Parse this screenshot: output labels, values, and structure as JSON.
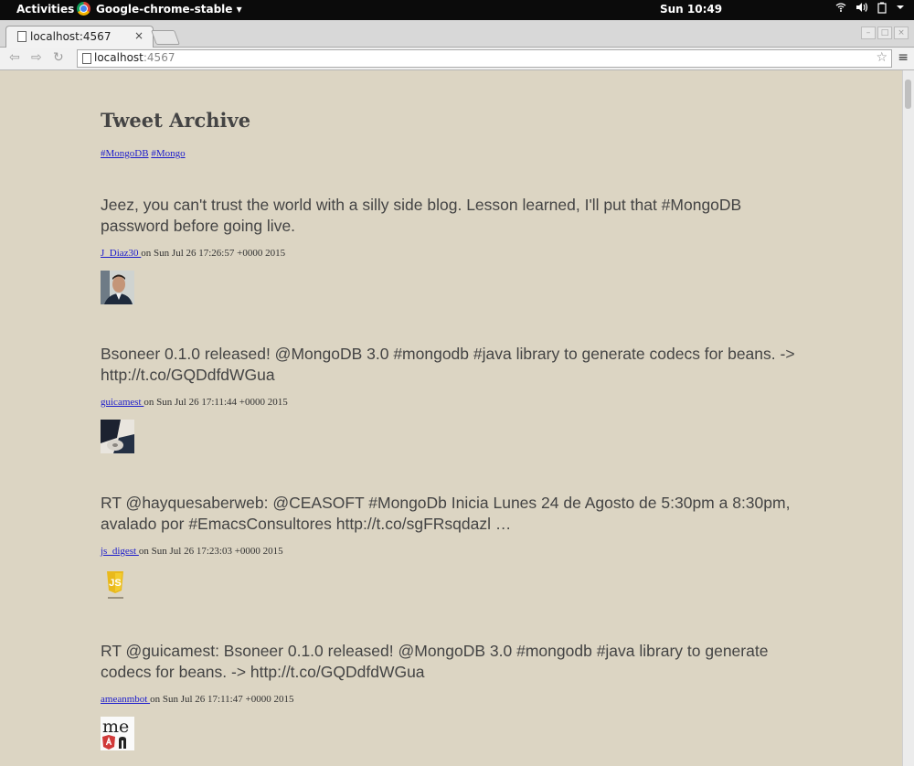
{
  "os": {
    "activities": "Activities",
    "app_menu": "Google-chrome-stable ▾",
    "clock": "Sun 10:49",
    "tray_icons": [
      "wifi-icon",
      "volume-icon",
      "battery-icon",
      "system-menu-icon"
    ]
  },
  "browser": {
    "tab_title": "localhost:4567",
    "url_host": "localhost",
    "url_port": ":4567"
  },
  "page": {
    "title": "Tweet Archive",
    "tags": [
      "#MongoDB",
      "#Mongo"
    ],
    "tweets": [
      {
        "text": "Jeez, you can't trust the world with a silly side blog. Lesson learned, I'll put that #MongoDB password before going live.",
        "user": "J_Diaz30 ",
        "date": " on Sun Jul 26 17:26:57 +0000 2015",
        "avatar": "person-photo"
      },
      {
        "text": "Bsoneer 0.1.0 released! @MongoDB 3.0 #mongodb #java library to generate codecs for beans. -> http://t.co/GQDdfdWGua",
        "user": "guicamest ",
        "date": " on Sun Jul 26 17:11:44 +0000 2015",
        "avatar": "dark-photo"
      },
      {
        "text": "RT @hayquesaberweb: @CEASOFT #MongoDb Inicia Lunes 24 de Agosto de 5:30pm a 8:30pm, avalado por #EmacsConsultores http://t.co/sgFRsqdazl …",
        "user": "js_digest ",
        "date": " on Sun Jul 26 17:23:03 +0000 2015",
        "avatar": "javascript-shield"
      },
      {
        "text": "RT @guicamest: Bsoneer 0.1.0 released! @MongoDB 3.0 #mongodb #java library to generate codecs for beans. -> http://t.co/GQDdfdWGua",
        "user": "ameanmbot ",
        "date": " on Sun Jul 26 17:11:47 +0000 2015",
        "avatar": "mean-logo",
        "avatar_text": "me"
      }
    ]
  },
  "colors": {
    "page_bg": "#dcd5c3",
    "link": "#1c1ccc",
    "tweet_text": "#444444"
  }
}
